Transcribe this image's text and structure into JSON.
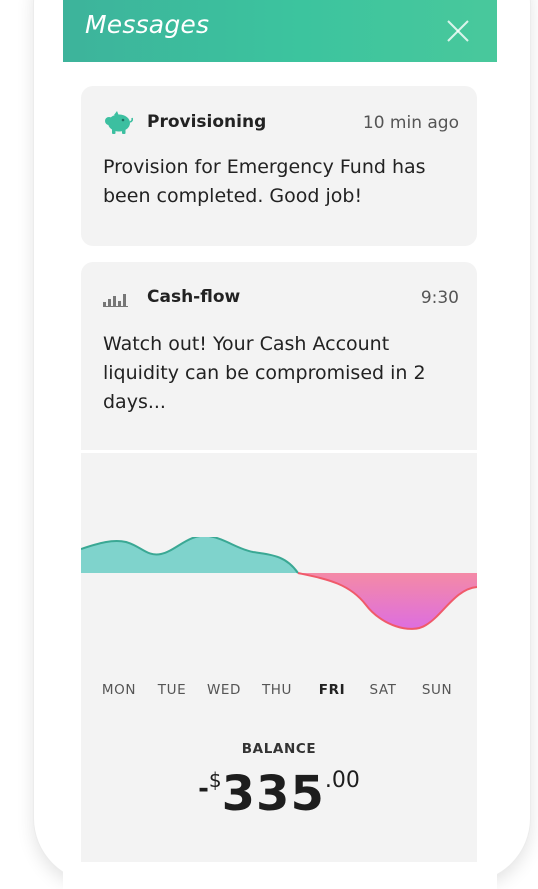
{
  "header": {
    "title": "Messages",
    "close_icon": "close-icon"
  },
  "messages": [
    {
      "icon": "piggy-bank-icon",
      "title": "Provisioning",
      "time": "10 min ago",
      "body": "Provision for Emergency Fund has been completed. Good job!"
    },
    {
      "icon": "bar-chart-icon",
      "title": "Cash-flow",
      "time": "9:30",
      "body": "Watch out! Your Cash Account liquidity can be compromised in 2 days..."
    }
  ],
  "cashflow": {
    "days": [
      "MON",
      "TUE",
      "WED",
      "THU",
      "FRI",
      "SAT",
      "SUN"
    ],
    "active_day": "FRI",
    "balance_label": "BALANCE",
    "balance_sign": "-",
    "balance_currency": "$",
    "balance_integer": "335",
    "balance_cents": ".00"
  },
  "colors": {
    "header_start": "#3db39b",
    "header_end": "#49c89c",
    "positive_area": "#7fd3cc",
    "positive_line": "#3aa894",
    "negative_top": "#f48aa6",
    "negative_bottom": "#dd6ee0",
    "negative_line": "#f05a6a",
    "card_bg": "#f3f3f3"
  }
}
